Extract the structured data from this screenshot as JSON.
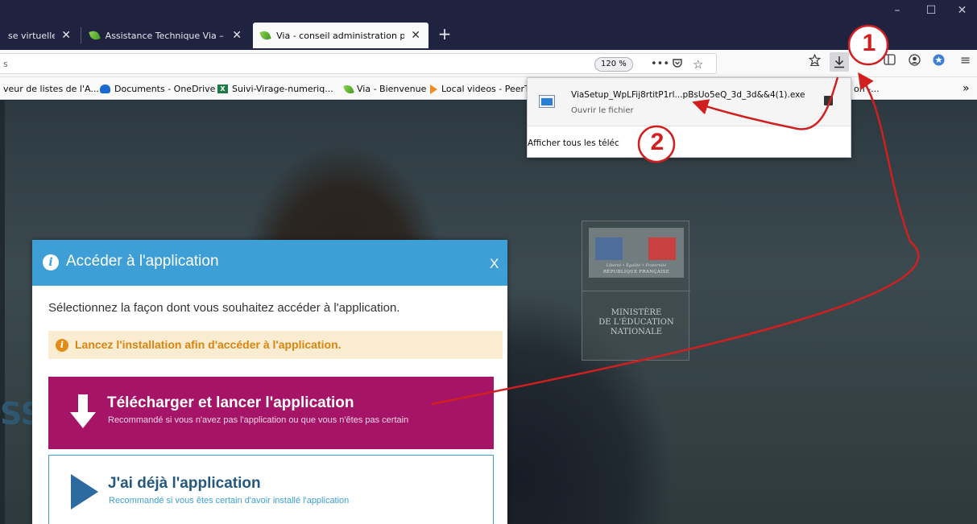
{
  "browser": {
    "tabs": [
      {
        "title": "se virtuelle e",
        "active": false
      },
      {
        "title": "Assistance Technique Via – SVI",
        "active": false
      },
      {
        "title": "Via - conseil administration pro",
        "active": true
      }
    ],
    "tab_close_glyph": "✕",
    "new_tab_glyph": "+",
    "window_controls": {
      "minimize": "–",
      "maximize": "☐",
      "close": "✕"
    },
    "zoom_level": "120 %",
    "url_fragment": "s",
    "toolbar_icons": [
      "page-actions-icon",
      "pocket-icon",
      "bookmark-star-icon",
      "library-icon",
      "download-icon",
      "sidebar-icon",
      "account-icon",
      "extension-icon",
      "menu-icon"
    ]
  },
  "bookmarks": [
    {
      "label": "veur de listes de l'A...",
      "icon": "none"
    },
    {
      "label": "Documents - OneDrive",
      "icon": "onedrive-cloud-icon"
    },
    {
      "label": "Suivi-Virage-numeriq...",
      "icon": "excel-icon"
    },
    {
      "label": "Via - Bienvenue",
      "icon": "via-leaf-icon"
    },
    {
      "label": "Local videos - PeerT",
      "icon": "peertube-icon"
    }
  ],
  "bookmarks_overflow": "»",
  "bookmarks_trailing": "on -...",
  "downloads_panel": {
    "file_name": "ViaSetup_WpLFij8rtitP1rl...pBsUo5eQ_3d_3d&&4(1).exe",
    "status": "Ouvrir le fichier",
    "show_all": "Afficher tous les téléc"
  },
  "background": {
    "ministry_motto": "Liberté • Égalité • Fraternité",
    "ministry_republic": "RÉPUBLIQUE FRANÇAISE",
    "ministry_line1": "MINISTÈRE",
    "ministry_line2": "DE L'ÉDUCATION",
    "ministry_line3": "NATIONALE",
    "big_letters": "SS"
  },
  "dialog": {
    "title": "Accéder à l'application",
    "close": "X",
    "instruction": "Sélectionnez la façon dont vous souhaitez accéder à l'application.",
    "notice": "Lancez l'installation afin d'accéder à l'application.",
    "options": [
      {
        "title": "Télécharger et lancer l'application",
        "subtitle": "Recommandé si vous n'avez pas l'application ou que vous n'êtes pas certain"
      },
      {
        "title": "J'ai déjà l'application",
        "subtitle": "Recommandé si vous êtes certain d'avoir installé l'application"
      }
    ]
  },
  "annotations": {
    "step1": "1",
    "step2": "2",
    "color": "#d11f1f"
  },
  "colors": {
    "tab_bar": "#202340",
    "dialog_header": "#3d9fd5",
    "download_option": "#a51467",
    "notice_bg": "#faecd0",
    "notice_text": "#d9840e"
  }
}
